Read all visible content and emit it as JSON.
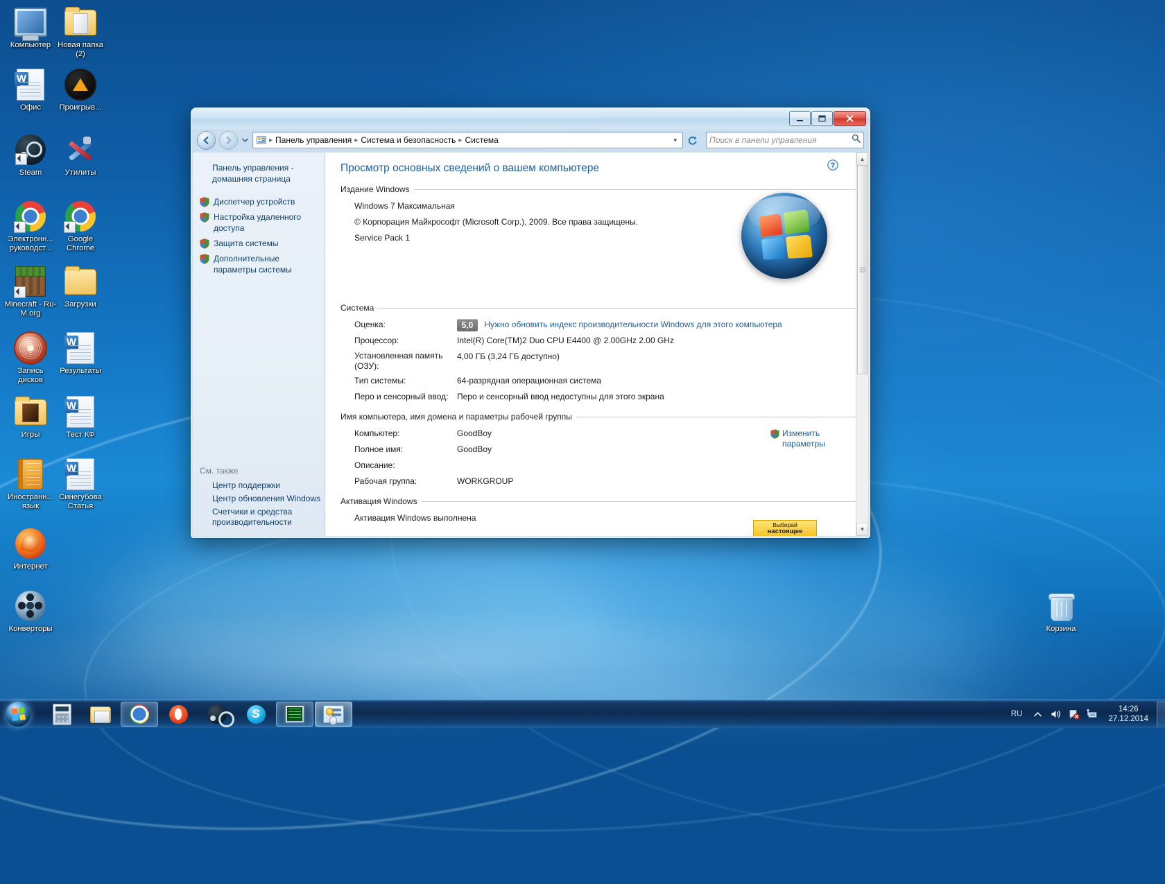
{
  "desktop": {
    "icons": [
      {
        "label": "Компьютер",
        "icon": "computer-icon",
        "shortcut": false
      },
      {
        "label": "Новая папка (2)",
        "icon": "folder-open-icon",
        "shortcut": false
      },
      {
        "label": "Офис",
        "icon": "word-document-icon",
        "shortcut": false
      },
      {
        "label": "Проигрыв...",
        "icon": "aimp-player-icon",
        "shortcut": false
      },
      {
        "label": "Steam",
        "icon": "steam-icon",
        "shortcut": true
      },
      {
        "label": "Утилиты",
        "icon": "tools-icon",
        "shortcut": false
      },
      {
        "label": "Электронн... руководст...",
        "icon": "chrome-icon",
        "shortcut": true
      },
      {
        "label": "Google Chrome",
        "icon": "chrome-icon",
        "shortcut": true
      },
      {
        "label": "Minecraft - Ru-M.org",
        "icon": "minecraft-icon",
        "shortcut": true
      },
      {
        "label": "Загрузки",
        "icon": "folder-icon",
        "shortcut": false
      },
      {
        "label": "Запись дисков",
        "icon": "disc-burn-icon",
        "shortcut": false
      },
      {
        "label": "Результаты",
        "icon": "word-document-icon",
        "shortcut": false
      },
      {
        "label": "Игры",
        "icon": "folder-media-icon",
        "shortcut": false
      },
      {
        "label": "Тест КФ",
        "icon": "word-document-icon",
        "shortcut": false
      },
      {
        "label": "Иностранн... язык",
        "icon": "book-icon",
        "shortcut": false
      },
      {
        "label": "Синегубова Статья",
        "icon": "word-document-icon",
        "shortcut": false
      },
      {
        "label": "Интернет",
        "icon": "firefox-icon",
        "shortcut": false
      },
      {
        "label": "Конверторы",
        "icon": "film-reel-icon",
        "shortcut": false
      }
    ],
    "recycle_bin": {
      "label": "Корзина",
      "icon": "recycle-bin-icon"
    }
  },
  "window": {
    "controls": {
      "minimize": "minimize-button",
      "maximize": "maximize-button",
      "close": "close-button"
    },
    "nav": {
      "back": "back-button",
      "forward": "forward-button",
      "recent_pages": "recent-pages-dropdown",
      "refresh": "refresh-button",
      "address_dropdown": "address-dropdown"
    },
    "breadcrumb": [
      "Панель управления",
      "Система и безопасность",
      "Система"
    ],
    "search": {
      "placeholder": "Поиск в панели управления",
      "value": ""
    }
  },
  "sidebar": {
    "home": "Панель управления - домашняя страница",
    "items": [
      {
        "label": "Диспетчер устройств",
        "icon": "shield-icon"
      },
      {
        "label": "Настройка удаленного доступа",
        "icon": "shield-icon"
      },
      {
        "label": "Защита системы",
        "icon": "shield-icon"
      },
      {
        "label": "Дополнительные параметры системы",
        "icon": "shield-icon"
      }
    ],
    "see_also": {
      "header": "См. также",
      "items": [
        "Центр поддержки",
        "Центр обновления Windows",
        "Счетчики и средства производительности"
      ]
    }
  },
  "content": {
    "help_icon": "help-icon",
    "page_title": "Просмотр основных сведений о вашем компьютере",
    "sections": [
      {
        "title": "Издание Windows",
        "lines": [
          "Windows 7 Максимальная",
          "© Корпорация Майкрософт (Microsoft Corp.), 2009. Все права защищены.",
          "Service Pack 1"
        ]
      }
    ],
    "system": {
      "title": "Система",
      "rating_label": "Оценка:",
      "rating_value": "5,0",
      "rating_link": "Нужно обновить индекс производительности Windows для этого компьютера",
      "rows": [
        {
          "key": "Процессор:",
          "value": "Intel(R) Core(TM)2 Duo CPU     E4400  @ 2.00GHz  2.00 GHz"
        },
        {
          "key": "Установленная память (ОЗУ):",
          "value": "4,00 ГБ (3,24 ГБ доступно)"
        },
        {
          "key": "Тип системы:",
          "value": "64-разрядная операционная система"
        },
        {
          "key": "Перо и сенсорный ввод:",
          "value": "Перо и сенсорный ввод недоступны для этого экрана"
        }
      ]
    },
    "computer_name": {
      "title": "Имя компьютера, имя домена и параметры рабочей группы",
      "rows": [
        {
          "key": "Компьютер:",
          "value": "GoodBoy"
        },
        {
          "key": "Полное имя:",
          "value": "GoodBoy"
        },
        {
          "key": "Описание:",
          "value": ""
        },
        {
          "key": "Рабочая группа:",
          "value": "WORKGROUP"
        }
      ],
      "change_link": "Изменить параметры",
      "change_icon": "shield-icon"
    },
    "activation": {
      "title": "Активация Windows",
      "status": "Активация Windows выполнена"
    },
    "banner": {
      "line1": "Выбирай",
      "line2": "настоящее"
    },
    "scrollbar": {
      "up": "scroll-up-arrow",
      "down": "scroll-down-arrow",
      "thumb": "scroll-thumb"
    }
  },
  "taskbar": {
    "start": "start-orb",
    "items": [
      {
        "name": "calculator",
        "label": "Калькулятор",
        "state": "pinned"
      },
      {
        "name": "explorer",
        "label": "Проводник",
        "state": "pinned"
      },
      {
        "name": "chrome",
        "label": "Google Chrome",
        "state": "running"
      },
      {
        "name": "opera",
        "label": "Opera",
        "state": "pinned"
      },
      {
        "name": "steam",
        "label": "Steam",
        "state": "pinned"
      },
      {
        "name": "skype",
        "label": "Skype",
        "state": "pinned"
      },
      {
        "name": "monitor",
        "label": "Монитор",
        "state": "running"
      },
      {
        "name": "control-panel",
        "label": "Система",
        "state": "active"
      }
    ],
    "tray": {
      "language": "RU",
      "show_hidden": "show-hidden-icons",
      "volume": "volume-icon",
      "action_center": "action-center-icon",
      "network": "network-icon",
      "time": "14:26",
      "date": "27.12.2014",
      "show_desktop": "show-desktop-button"
    }
  },
  "colors": {
    "accent_link": "#1f5fa8",
    "title_blue": "#1f5fa8",
    "taskbar": "#0a264b",
    "desktop": "#1477c4",
    "close_red": "#cf3a2c",
    "banner_yellow": "#f4c527"
  }
}
